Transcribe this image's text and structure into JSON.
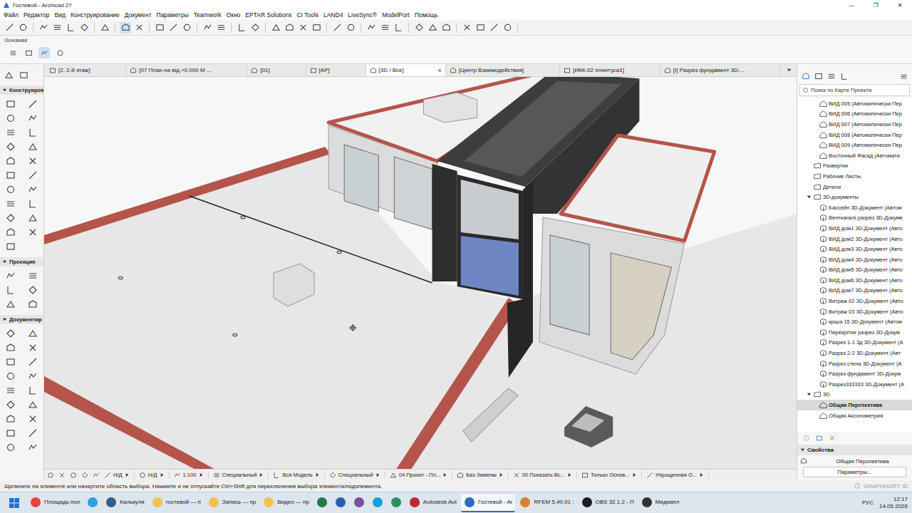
{
  "window": {
    "title": "Гостевой - Archicad 27",
    "controls": [
      "—",
      "❐",
      "✕"
    ]
  },
  "menu": [
    "Файл",
    "Редактор",
    "Вид",
    "Конструирование",
    "Документ",
    "Параметры",
    "Teamwork",
    "Окно",
    "EPTAR Solutions",
    "CI Tools",
    "LAND4",
    "LiveSync®",
    "ModelPort",
    "Помощь"
  ],
  "info_box": {
    "label": "Основная"
  },
  "tabs": {
    "close": "×",
    "items": [
      {
        "label": "[2. 2-й этаж]",
        "selected": false
      },
      {
        "label": "[07 План на від.+0.000 М ...",
        "selected": false
      },
      {
        "label": "[01]",
        "selected": false
      },
      {
        "label": "[АР]",
        "selected": false
      },
      {
        "label": "[3D / Все]",
        "selected": true
      },
      {
        "label": "[Центр Взаимодействия]",
        "selected": false
      },
      {
        "label": "[ИКК-02 плинтуса1]",
        "selected": false
      },
      {
        "label": "[I] Разрез фундамент 3D-...",
        "selected": false
      }
    ]
  },
  "toolbox": {
    "sections": [
      {
        "title": "Конструиров",
        "expanded": true
      },
      {
        "title": "Проекция",
        "expanded": true
      },
      {
        "title": "Документир",
        "expanded": true
      }
    ]
  },
  "navigator": {
    "search_placeholder": "Поиск по Карте Проекта",
    "items": [
      {
        "label": "ВИД 005 (Автоматически Пер",
        "level": 2,
        "kind": "view",
        "selected": false
      },
      {
        "label": "ВИД 006 (Автоматически Пер",
        "level": 2,
        "kind": "view",
        "selected": false
      },
      {
        "label": "ВИД 007 (Автоматически Пер",
        "level": 2,
        "kind": "view",
        "selected": false
      },
      {
        "label": "ВИД 008 (Автоматически Пер",
        "level": 2,
        "kind": "view",
        "selected": false
      },
      {
        "label": "ВИД 009 (Автоматически Пер",
        "level": 2,
        "kind": "view",
        "selected": false
      },
      {
        "label": "Восточный Фасад (Автомати",
        "level": 2,
        "kind": "view",
        "selected": false
      },
      {
        "label": "Развертки",
        "level": 1,
        "kind": "folder",
        "selected": false
      },
      {
        "label": "Рабочие Листы",
        "level": 1,
        "kind": "folder",
        "selected": false
      },
      {
        "label": "Детали",
        "level": 1,
        "kind": "folder",
        "selected": false
      },
      {
        "label": "3D-документы",
        "level": 1,
        "kind": "group",
        "expanded": true,
        "selected": false
      },
      {
        "label": "Бассейн 3D-Документ (Автом",
        "level": 2,
        "kind": "document",
        "selected": false
      },
      {
        "label": "Вентканалі разрез 3D-Докуме",
        "level": 2,
        "kind": "document",
        "selected": false
      },
      {
        "label": "ВИД дом1 3D-Документ (Авто",
        "level": 2,
        "kind": "document",
        "selected": false
      },
      {
        "label": "ВИД дом2 3D-Документ (Авто",
        "level": 2,
        "kind": "document",
        "selected": false
      },
      {
        "label": "ВИД дом3 3D-Документ (Авто",
        "level": 2,
        "kind": "document",
        "selected": false
      },
      {
        "label": "ВИД дом4 3D-Документ (Авто",
        "level": 2,
        "kind": "document",
        "selected": false
      },
      {
        "label": "ВИД дом5 3D-Документ (Авто",
        "level": 2,
        "kind": "document",
        "selected": false
      },
      {
        "label": "ВИД дом6 3D-Документ (Авто",
        "level": 2,
        "kind": "document",
        "selected": false
      },
      {
        "label": "ВИД дом7 3D-Документ (Авто",
        "level": 2,
        "kind": "document",
        "selected": false
      },
      {
        "label": "Витраж 02 3D-Документ (Авто",
        "level": 2,
        "kind": "document",
        "selected": false
      },
      {
        "label": "Витраж 03 3D-Документ (Авто",
        "level": 2,
        "kind": "document",
        "selected": false
      },
      {
        "label": "кріша 15 3D-Документ (Автом",
        "level": 2,
        "kind": "document",
        "selected": false
      },
      {
        "label": "Перекрітие разрез 3D-Докум",
        "level": 2,
        "kind": "document",
        "selected": false
      },
      {
        "label": "Разрез 1-1 3д 3D-Документ (А",
        "level": 2,
        "kind": "document",
        "selected": false
      },
      {
        "label": "Разрез 2-2 3D-Документ (Авт",
        "level": 2,
        "kind": "document",
        "selected": false
      },
      {
        "label": "Разрез стена 3D-Документ (А",
        "level": 2,
        "kind": "document",
        "selected": false
      },
      {
        "label": "Разрез фундамент 3D-Докум",
        "level": 2,
        "kind": "document",
        "selected": false
      },
      {
        "label": "Разрез333333 3D-Документ (А",
        "level": 2,
        "kind": "document",
        "selected": false
      },
      {
        "label": "3D",
        "level": 1,
        "kind": "group",
        "expanded": true,
        "selected": false
      },
      {
        "label": "Общая Перспектива",
        "level": 2,
        "kind": "view",
        "selected": true
      },
      {
        "label": "Общая Аксонометрия",
        "level": 2,
        "kind": "view",
        "selected": false
      }
    ]
  },
  "properties": {
    "title": "Свойства",
    "value": "Общая Перспектива",
    "button": "Параметры..."
  },
  "view_controls": [
    "Н/Д",
    "Н/Д",
    "1:100",
    "Специальный",
    "Вся Модель",
    "Специальный",
    "04 Проект - Пл...",
    "Без Замены",
    "00 Показать Вс...",
    "Только Основ...",
    "Упрощенная О..."
  ],
  "status_bar": {
    "message": "Щелкните на элементе или начертите область выбора. Нажмите и не отпускайте Ctrl+Shift для переключения выбора элемента/подэлемента.",
    "brand": "GRAPHISOFT ID"
  },
  "taskbar": {
    "apps": [
      {
        "label": "Площадь пол",
        "color": "#e8453c",
        "active": false
      },
      {
        "label": "",
        "color": "#2aa3e0",
        "active": false
      },
      {
        "label": "Калькуля",
        "color": "#3a5a8a",
        "active": false
      },
      {
        "label": "гостевой — п",
        "color": "#f2c14e",
        "active": false
      },
      {
        "label": "Запись — пр",
        "color": "#f2c14e",
        "active": false
      },
      {
        "label": "Видео — пр",
        "color": "#f2c14e",
        "active": false
      },
      {
        "label": "",
        "color": "#1f7a45",
        "active": false
      },
      {
        "label": "",
        "color": "#2b5fb4",
        "active": false
      },
      {
        "label": "",
        "color": "#7b519d",
        "active": false
      },
      {
        "label": "",
        "color": "#1a9dd9",
        "active": false
      },
      {
        "label": "",
        "color": "#2f8f5b",
        "active": false
      },
      {
        "label": "Autodesk Aut",
        "color": "#c4262e",
        "active": false
      },
      {
        "label": "Гостевой - Ar",
        "color": "#2f6db5",
        "active": true
      },
      {
        "label": "RFEM 5.40.01 :",
        "color": "#d9822b",
        "active": false
      },
      {
        "label": "OBS 32.1.2 - П",
        "color": "#1d1d1d",
        "active": false
      },
      {
        "label": "Медиапл",
        "color": "#333333",
        "active": false
      }
    ],
    "language": "РУС",
    "time": "12:17",
    "date": "14.05.2026"
  }
}
